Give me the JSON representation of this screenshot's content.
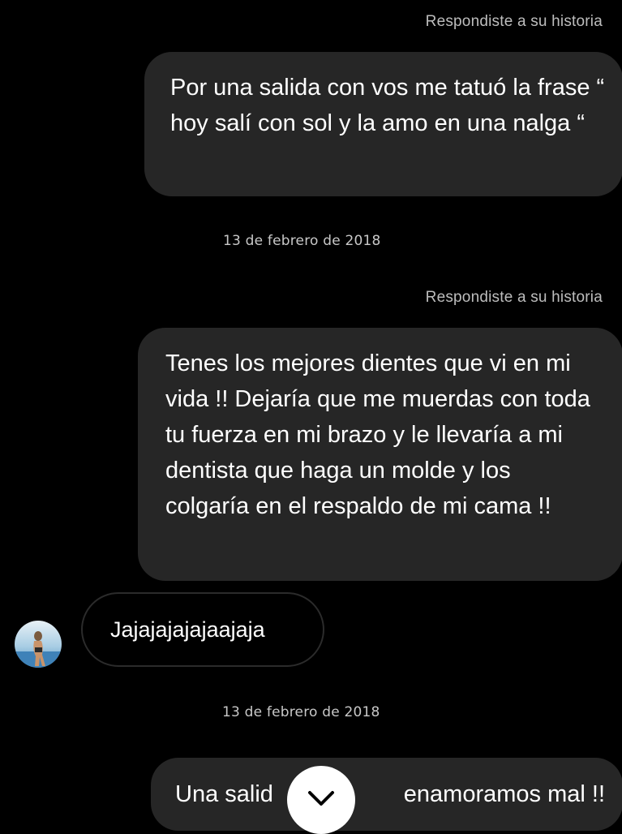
{
  "messages": {
    "reply_note_1": "Respondiste a su historia",
    "bubble_1": "Por una salida con vos me tatuó la frase “ hoy salí con sol y la amo en una nalga “",
    "date_1": "13 de febrero de 2018",
    "reply_note_2": "Respondiste a su historia",
    "bubble_2": "Tenes los mejores dientes que vi en mi vida !! Dejaría que me muerdas con toda tu fuerza en mi brazo y le llevaría a mi dentista que haga un molde y los colgaría en el respaldo de mi cama !!",
    "reply_bubble": "Jajajajajajaajaja",
    "date_2": "13 de febrero de 2018",
    "bubble_3_left": "Una salid",
    "bubble_3_right": "enamoramos mal !!"
  },
  "icons": {
    "avatar": "user-avatar",
    "scroll": "chevron-down-icon"
  },
  "colors": {
    "background": "#000000",
    "outgoing_bubble": "#262626",
    "incoming_border": "#2b2b2b",
    "meta_text": "#bdbdbd"
  }
}
